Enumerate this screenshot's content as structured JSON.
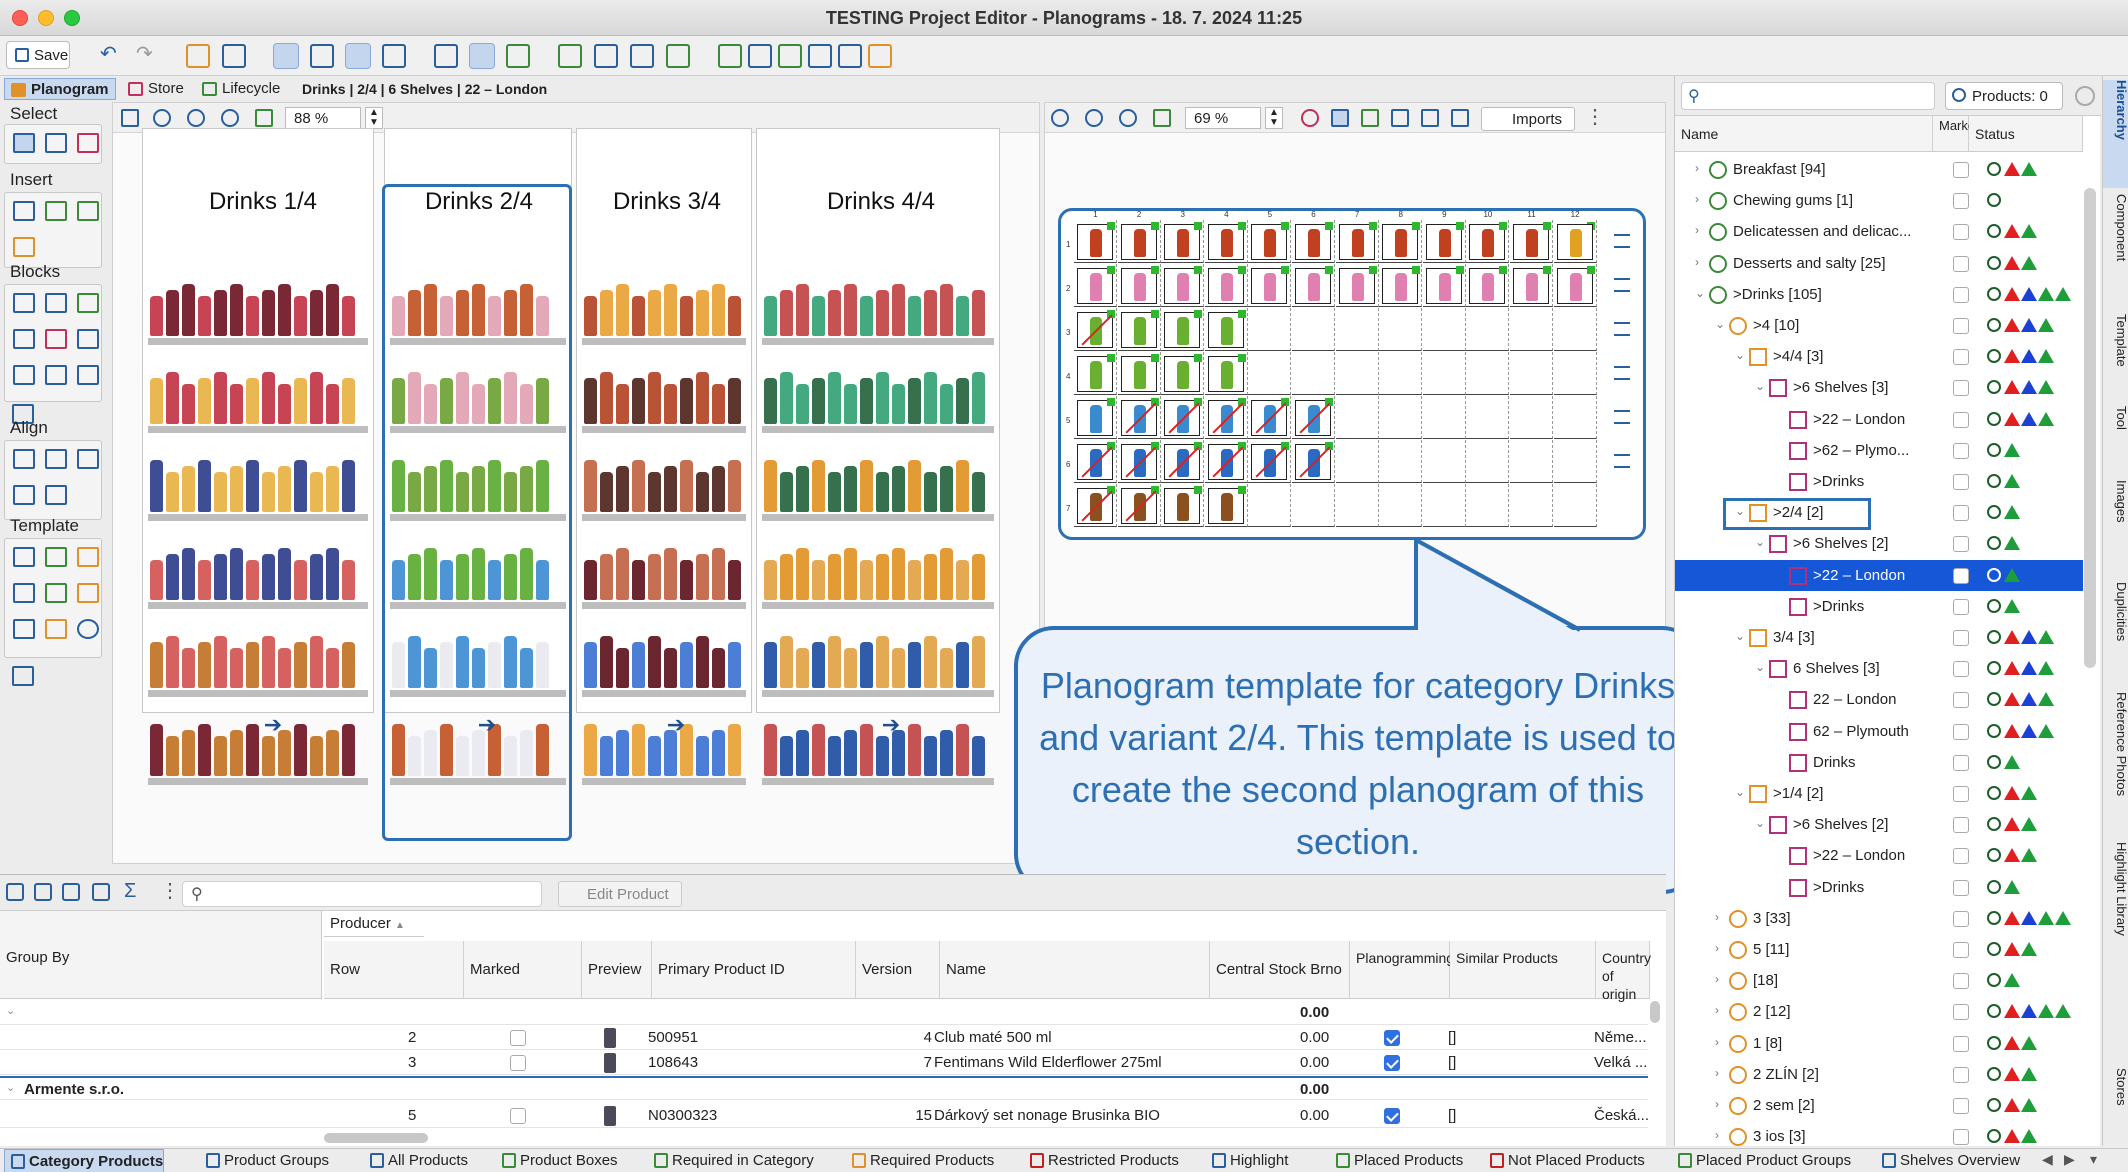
{
  "window": {
    "title": "TESTING Project Editor - Planograms - 18. 7. 2024 11:25"
  },
  "toolbar": {
    "save_label": "Save"
  },
  "tabs": [
    {
      "label": "Planogram",
      "active": true
    },
    {
      "label": "Store",
      "active": false
    },
    {
      "label": "Lifecycle",
      "active": false
    }
  ],
  "breadcrumb": "Drinks | 2/4 | 6 Shelves | 22 – London",
  "palette": {
    "select": "Select",
    "insert": "Insert",
    "blocks": "Blocks",
    "align": "Align",
    "template": "Template"
  },
  "left_pane": {
    "zoom": "88 %"
  },
  "mid_pane": {
    "zoom": "69 %",
    "imports_label": "Imports"
  },
  "gondolas": [
    {
      "title": "Drinks 1/4"
    },
    {
      "title": "Drinks 2/4"
    },
    {
      "title": "Drinks 3/4"
    },
    {
      "title": "Drinks 4/4"
    }
  ],
  "grid": {
    "columns": [
      "1",
      "2",
      "3",
      "4",
      "5",
      "6",
      "7",
      "8",
      "9",
      "10",
      "11",
      "12"
    ],
    "rows": [
      "1",
      "2",
      "3",
      "4",
      "5",
      "6",
      "7"
    ]
  },
  "callout": {
    "text": "Planogram template for category Drinks and variant 2/4. This template is used to create the second planogram of this section."
  },
  "table": {
    "edit_label": "Edit Product",
    "group_by_label": "Group By",
    "group_column": "Producer",
    "headers": [
      "Row",
      "Marked",
      "Preview",
      "Primary Product ID",
      "Version",
      "Name",
      "Central Stock Brno",
      "Planogramming",
      "Similar Products",
      "Country of origin"
    ],
    "rows": [
      {
        "kind": "total",
        "stock": "0.00"
      },
      {
        "kind": "item",
        "row": "2",
        "id": "500951",
        "version": "4",
        "name": "Club maté 500 ml",
        "stock": "0.00",
        "planogramming": true,
        "similar": "[]",
        "country": "Něme..."
      },
      {
        "kind": "item",
        "row": "3",
        "id": "108643",
        "version": "7",
        "name": "Fentimans Wild Elderflower 275ml",
        "stock": "0.00",
        "planogramming": true,
        "similar": "[]",
        "country": "Velká ..."
      },
      {
        "kind": "group",
        "label": "Armente s.r.o.",
        "stock": "0.00"
      },
      {
        "kind": "item",
        "row": "5",
        "id": "N0300323",
        "version": "15",
        "name": "Dárkový set nonage Brusinka BIO",
        "stock": "0.00",
        "planogramming": true,
        "similar": "[]",
        "country": "Česká..."
      }
    ]
  },
  "hierarchy": {
    "products_label": "Products: 0",
    "headers": {
      "name": "Name",
      "marked": "Marked",
      "status": "Status"
    },
    "items": [
      {
        "label": "Breakfast [94]",
        "indent": 0,
        "expander": "›",
        "status": [
          "red",
          "green"
        ]
      },
      {
        "label": "Chewing gums [1]",
        "indent": 0,
        "expander": "›",
        "status": []
      },
      {
        "label": "Delicatessen and delicac...",
        "indent": 0,
        "expander": "›",
        "status": [
          "red",
          "green"
        ]
      },
      {
        "label": "Desserts and salty [25]",
        "indent": 0,
        "expander": "›",
        "status": [
          "red",
          "green"
        ]
      },
      {
        "label": ">Drinks [105]",
        "indent": 0,
        "expander": "⌄",
        "status": [
          "red",
          "blue",
          "green",
          "green"
        ]
      },
      {
        "label": ">4 [10]",
        "indent": 1,
        "expander": "⌄",
        "status": [
          "red",
          "blue",
          "green"
        ]
      },
      {
        "label": ">4/4 [3]",
        "indent": 2,
        "expander": "⌄",
        "status": [
          "red",
          "blue",
          "green"
        ]
      },
      {
        "label": ">6 Shelves [3]",
        "indent": 3,
        "expander": "⌄",
        "status": [
          "red",
          "blue",
          "green"
        ]
      },
      {
        "label": ">22 – London",
        "indent": 4,
        "expander": "",
        "status": [
          "red",
          "blue",
          "green"
        ]
      },
      {
        "label": ">62 – Plymo...",
        "indent": 4,
        "expander": "",
        "status": [
          "green"
        ]
      },
      {
        "label": ">Drinks",
        "indent": 4,
        "expander": "",
        "status": [
          "green"
        ]
      },
      {
        "label": ">2/4 [2]",
        "indent": 2,
        "expander": "⌄",
        "status": [
          "green"
        ]
      },
      {
        "label": ">6 Shelves [2]",
        "indent": 3,
        "expander": "⌄",
        "status": [
          "green"
        ]
      },
      {
        "label": ">22 – London",
        "indent": 4,
        "expander": "",
        "status": [
          "green"
        ],
        "selected": true
      },
      {
        "label": ">Drinks",
        "indent": 4,
        "expander": "",
        "status": [
          "green"
        ]
      },
      {
        "label": "3/4 [3]",
        "indent": 2,
        "expander": "⌄",
        "status": [
          "red",
          "blue",
          "green"
        ]
      },
      {
        "label": "6 Shelves [3]",
        "indent": 3,
        "expander": "⌄",
        "status": [
          "red",
          "blue",
          "green"
        ]
      },
      {
        "label": "22 – London",
        "indent": 4,
        "expander": "",
        "status": [
          "red",
          "blue",
          "green"
        ]
      },
      {
        "label": "62 – Plymouth",
        "indent": 4,
        "expander": "",
        "status": [
          "red",
          "blue",
          "green"
        ]
      },
      {
        "label": "Drinks",
        "indent": 4,
        "expander": "",
        "status": [
          "green"
        ]
      },
      {
        "label": ">1/4 [2]",
        "indent": 2,
        "expander": "⌄",
        "status": [
          "red",
          "green"
        ]
      },
      {
        "label": ">6 Shelves [2]",
        "indent": 3,
        "expander": "⌄",
        "status": [
          "red",
          "green"
        ]
      },
      {
        "label": ">22 – London",
        "indent": 4,
        "expander": "",
        "status": [
          "red",
          "green"
        ]
      },
      {
        "label": ">Drinks",
        "indent": 4,
        "expander": "",
        "status": [
          "green"
        ]
      },
      {
        "label": "3 [33]",
        "indent": 1,
        "expander": "›",
        "status": [
          "red",
          "blue",
          "green",
          "green"
        ]
      },
      {
        "label": "5 [11]",
        "indent": 1,
        "expander": "›",
        "status": [
          "red",
          "green"
        ]
      },
      {
        "label": " [18]",
        "indent": 1,
        "expander": "›",
        "status": [
          "green"
        ]
      },
      {
        "label": "2 [12]",
        "indent": 1,
        "expander": "›",
        "status": [
          "red",
          "blue",
          "green",
          "green"
        ]
      },
      {
        "label": "1 [8]",
        "indent": 1,
        "expander": "›",
        "status": [
          "red",
          "green"
        ]
      },
      {
        "label": "2 ZLÍN [2]",
        "indent": 1,
        "expander": "›",
        "status": [
          "red",
          "green"
        ]
      },
      {
        "label": "2 sem [2]",
        "indent": 1,
        "expander": "›",
        "status": [
          "red",
          "green"
        ]
      },
      {
        "label": "3 ios [3]",
        "indent": 1,
        "expander": "›",
        "status": [
          "red",
          "green"
        ]
      }
    ]
  },
  "side_tabs": [
    "Hierarchy",
    "Component",
    "Template",
    "Tool",
    "Images",
    "Duplicities",
    "Reference Photos",
    "Highlight Library",
    "Stores"
  ],
  "bottom_tabs": [
    {
      "label": "Category Products",
      "active": true,
      "kind": ""
    },
    {
      "label": "Product Groups",
      "kind": ""
    },
    {
      "label": "All Products",
      "kind": ""
    },
    {
      "label": "Product Boxes",
      "kind": "grn"
    },
    {
      "label": "Required in Category",
      "kind": "grn"
    },
    {
      "label": "Required Products",
      "kind": "org"
    },
    {
      "label": "Restricted Products",
      "kind": "red"
    },
    {
      "label": "Highlight",
      "kind": ""
    },
    {
      "label": "Placed Products",
      "kind": "grn"
    },
    {
      "label": "Not Placed Products",
      "kind": "red"
    },
    {
      "label": "Placed Product Groups",
      "kind": "grn"
    },
    {
      "label": "Shelves Overview",
      "kind": ""
    }
  ],
  "colors": {
    "accent": "#2c6fb3",
    "selection": "#1557d6",
    "status_red": "#e02020",
    "status_blue": "#1c3fd6",
    "status_green": "#1e9e3a"
  }
}
